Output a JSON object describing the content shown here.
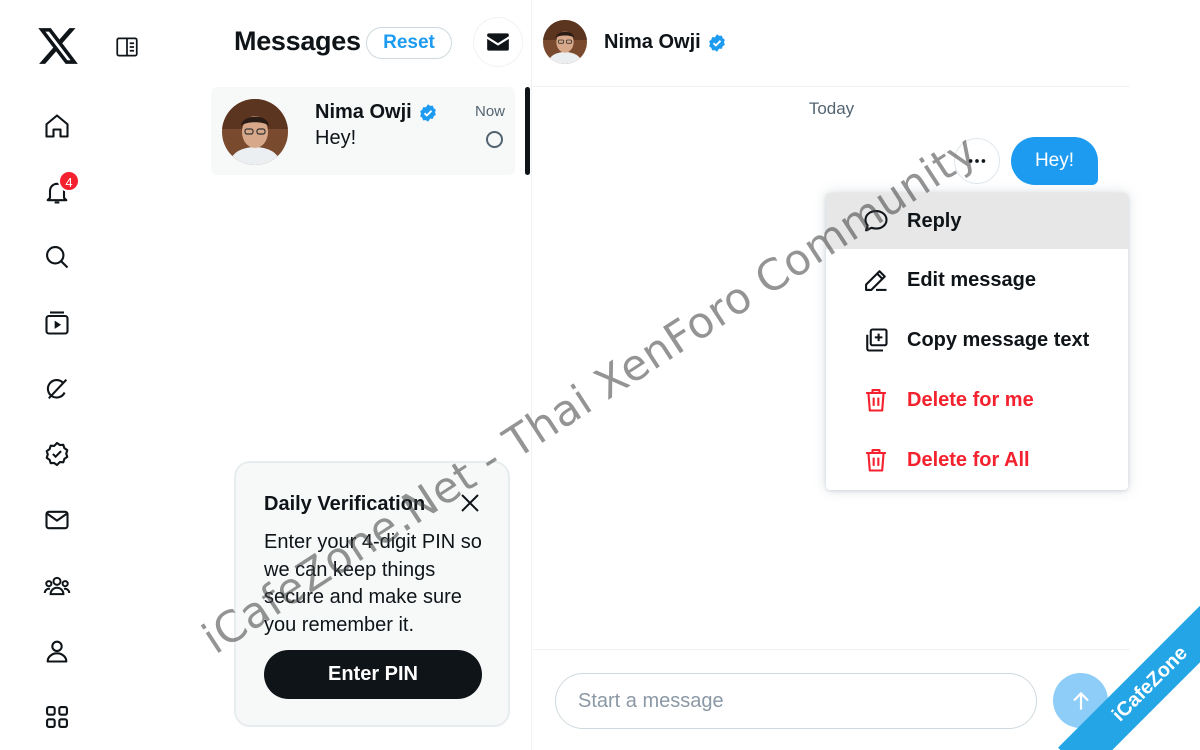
{
  "sidebar": {
    "logo_icon": "x-logo-icon",
    "notifications_count": "4",
    "items": [
      {
        "icon": "home-icon"
      },
      {
        "icon": "bell-icon"
      },
      {
        "icon": "search-icon"
      },
      {
        "icon": "video-icon"
      },
      {
        "icon": "grok-icon"
      },
      {
        "icon": "verified-badge-icon"
      },
      {
        "icon": "mail-icon"
      },
      {
        "icon": "communities-icon"
      },
      {
        "icon": "profile-icon"
      },
      {
        "icon": "more-apps-icon"
      }
    ]
  },
  "messages": {
    "title": "Messages",
    "reset_label": "Reset",
    "conversations": [
      {
        "name": "Nima Owji",
        "time": "Now",
        "preview": "Hey!",
        "verified": true
      }
    ]
  },
  "verification_card": {
    "title": "Daily Verification",
    "body": "Enter your 4-digit PIN so we can keep things secure and make sure you remember it.",
    "button_label": "Enter PIN"
  },
  "chat": {
    "contact_name": "Nima Owji",
    "day_label": "Today",
    "bubble_text": "Hey!",
    "menu": [
      {
        "label": "Reply",
        "icon": "reply-bubble-icon",
        "danger": false
      },
      {
        "label": "Edit message",
        "icon": "pencil-icon",
        "danger": false
      },
      {
        "label": "Copy message text",
        "icon": "copy-icon",
        "danger": false
      },
      {
        "label": "Delete for me",
        "icon": "trash-icon",
        "danger": true
      },
      {
        "label": "Delete for All",
        "icon": "trash-icon",
        "danger": true
      }
    ],
    "input_placeholder": "Start a message"
  },
  "watermark": {
    "text": "iCafeZone.Net - Thai XenForo Community",
    "corner_text": "iCafeZone"
  },
  "colors": {
    "accent": "#1d9bf0",
    "danger": "#f4212e",
    "text": "#0f1419",
    "muted": "#536471"
  }
}
